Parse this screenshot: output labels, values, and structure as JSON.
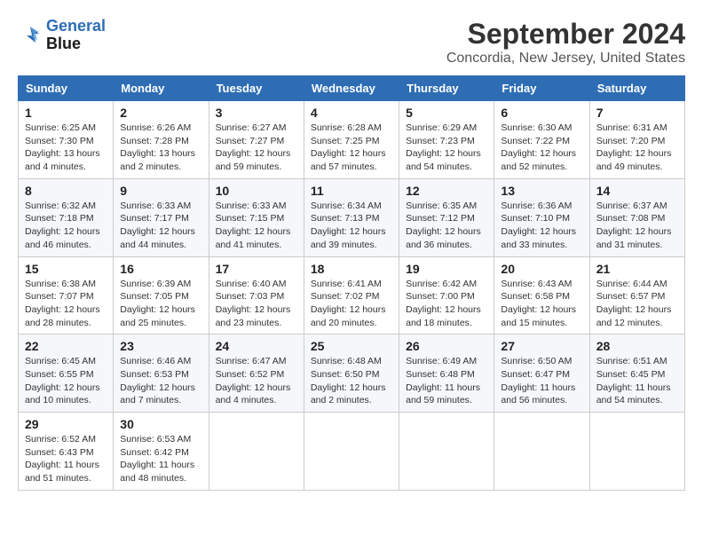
{
  "header": {
    "logo_line1": "General",
    "logo_line2": "Blue",
    "month": "September 2024",
    "location": "Concordia, New Jersey, United States"
  },
  "days_of_week": [
    "Sunday",
    "Monday",
    "Tuesday",
    "Wednesday",
    "Thursday",
    "Friday",
    "Saturday"
  ],
  "weeks": [
    [
      {
        "day": "1",
        "detail": "Sunrise: 6:25 AM\nSunset: 7:30 PM\nDaylight: 13 hours\nand 4 minutes."
      },
      {
        "day": "2",
        "detail": "Sunrise: 6:26 AM\nSunset: 7:28 PM\nDaylight: 13 hours\nand 2 minutes."
      },
      {
        "day": "3",
        "detail": "Sunrise: 6:27 AM\nSunset: 7:27 PM\nDaylight: 12 hours\nand 59 minutes."
      },
      {
        "day": "4",
        "detail": "Sunrise: 6:28 AM\nSunset: 7:25 PM\nDaylight: 12 hours\nand 57 minutes."
      },
      {
        "day": "5",
        "detail": "Sunrise: 6:29 AM\nSunset: 7:23 PM\nDaylight: 12 hours\nand 54 minutes."
      },
      {
        "day": "6",
        "detail": "Sunrise: 6:30 AM\nSunset: 7:22 PM\nDaylight: 12 hours\nand 52 minutes."
      },
      {
        "day": "7",
        "detail": "Sunrise: 6:31 AM\nSunset: 7:20 PM\nDaylight: 12 hours\nand 49 minutes."
      }
    ],
    [
      {
        "day": "8",
        "detail": "Sunrise: 6:32 AM\nSunset: 7:18 PM\nDaylight: 12 hours\nand 46 minutes."
      },
      {
        "day": "9",
        "detail": "Sunrise: 6:33 AM\nSunset: 7:17 PM\nDaylight: 12 hours\nand 44 minutes."
      },
      {
        "day": "10",
        "detail": "Sunrise: 6:33 AM\nSunset: 7:15 PM\nDaylight: 12 hours\nand 41 minutes."
      },
      {
        "day": "11",
        "detail": "Sunrise: 6:34 AM\nSunset: 7:13 PM\nDaylight: 12 hours\nand 39 minutes."
      },
      {
        "day": "12",
        "detail": "Sunrise: 6:35 AM\nSunset: 7:12 PM\nDaylight: 12 hours\nand 36 minutes."
      },
      {
        "day": "13",
        "detail": "Sunrise: 6:36 AM\nSunset: 7:10 PM\nDaylight: 12 hours\nand 33 minutes."
      },
      {
        "day": "14",
        "detail": "Sunrise: 6:37 AM\nSunset: 7:08 PM\nDaylight: 12 hours\nand 31 minutes."
      }
    ],
    [
      {
        "day": "15",
        "detail": "Sunrise: 6:38 AM\nSunset: 7:07 PM\nDaylight: 12 hours\nand 28 minutes."
      },
      {
        "day": "16",
        "detail": "Sunrise: 6:39 AM\nSunset: 7:05 PM\nDaylight: 12 hours\nand 25 minutes."
      },
      {
        "day": "17",
        "detail": "Sunrise: 6:40 AM\nSunset: 7:03 PM\nDaylight: 12 hours\nand 23 minutes."
      },
      {
        "day": "18",
        "detail": "Sunrise: 6:41 AM\nSunset: 7:02 PM\nDaylight: 12 hours\nand 20 minutes."
      },
      {
        "day": "19",
        "detail": "Sunrise: 6:42 AM\nSunset: 7:00 PM\nDaylight: 12 hours\nand 18 minutes."
      },
      {
        "day": "20",
        "detail": "Sunrise: 6:43 AM\nSunset: 6:58 PM\nDaylight: 12 hours\nand 15 minutes."
      },
      {
        "day": "21",
        "detail": "Sunrise: 6:44 AM\nSunset: 6:57 PM\nDaylight: 12 hours\nand 12 minutes."
      }
    ],
    [
      {
        "day": "22",
        "detail": "Sunrise: 6:45 AM\nSunset: 6:55 PM\nDaylight: 12 hours\nand 10 minutes."
      },
      {
        "day": "23",
        "detail": "Sunrise: 6:46 AM\nSunset: 6:53 PM\nDaylight: 12 hours\nand 7 minutes."
      },
      {
        "day": "24",
        "detail": "Sunrise: 6:47 AM\nSunset: 6:52 PM\nDaylight: 12 hours\nand 4 minutes."
      },
      {
        "day": "25",
        "detail": "Sunrise: 6:48 AM\nSunset: 6:50 PM\nDaylight: 12 hours\nand 2 minutes."
      },
      {
        "day": "26",
        "detail": "Sunrise: 6:49 AM\nSunset: 6:48 PM\nDaylight: 11 hours\nand 59 minutes."
      },
      {
        "day": "27",
        "detail": "Sunrise: 6:50 AM\nSunset: 6:47 PM\nDaylight: 11 hours\nand 56 minutes."
      },
      {
        "day": "28",
        "detail": "Sunrise: 6:51 AM\nSunset: 6:45 PM\nDaylight: 11 hours\nand 54 minutes."
      }
    ],
    [
      {
        "day": "29",
        "detail": "Sunrise: 6:52 AM\nSunset: 6:43 PM\nDaylight: 11 hours\nand 51 minutes."
      },
      {
        "day": "30",
        "detail": "Sunrise: 6:53 AM\nSunset: 6:42 PM\nDaylight: 11 hours\nand 48 minutes."
      },
      {
        "day": "",
        "detail": ""
      },
      {
        "day": "",
        "detail": ""
      },
      {
        "day": "",
        "detail": ""
      },
      {
        "day": "",
        "detail": ""
      },
      {
        "day": "",
        "detail": ""
      }
    ]
  ]
}
